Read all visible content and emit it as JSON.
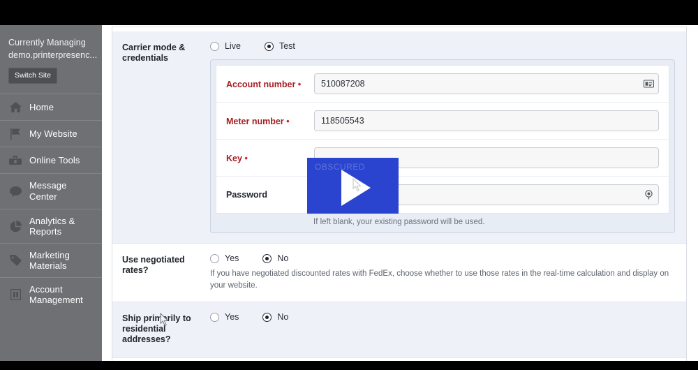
{
  "sidebar": {
    "managing_label": "Currently Managing",
    "site_name": "demo.printerpresenc...",
    "switch_site_label": "Switch Site",
    "items": [
      {
        "label": "Home",
        "icon": "home-icon"
      },
      {
        "label": "My Website",
        "icon": "flag-icon"
      },
      {
        "label": "Online Tools",
        "icon": "toolbox-icon"
      },
      {
        "label": "Message Center",
        "icon": "chat-bubble-icon"
      },
      {
        "label": "Analytics & Reports",
        "icon": "pie-chart-icon"
      },
      {
        "label": "Marketing Materials",
        "icon": "tag-icon"
      },
      {
        "label": "Account Management",
        "icon": "building-icon"
      }
    ]
  },
  "form": {
    "carrier_mode": {
      "label": "Carrier mode & credentials",
      "options": [
        {
          "label": "Live",
          "selected": false
        },
        {
          "label": "Test",
          "selected": true
        }
      ],
      "fields": [
        {
          "label": "Account number",
          "required": true,
          "value": "510087208",
          "icon": "contact-card-icon"
        },
        {
          "label": "Meter number",
          "required": true,
          "value": "118505543",
          "icon": ""
        },
        {
          "label": "Key",
          "required": true,
          "value": "",
          "icon": ""
        },
        {
          "label": "Password",
          "required": false,
          "value": "",
          "icon": "key-icon"
        }
      ],
      "password_hint": "If left blank, your existing password will be used."
    },
    "negotiated_rates": {
      "label": "Use negotiated rates?",
      "options": [
        {
          "label": "Yes",
          "selected": false
        },
        {
          "label": "No",
          "selected": true
        }
      ],
      "help": "If you have negotiated discounted rates with FedEx, choose whether to use those rates in the real-time calculation and display on your website."
    },
    "residential": {
      "label": "Ship primarily to residential addresses?",
      "options": [
        {
          "label": "Yes",
          "selected": false
        },
        {
          "label": "No",
          "selected": true
        }
      ]
    }
  },
  "video_overlay": {
    "play_label": "play-button",
    "obscured_text": "OBSCURED",
    "color": "#2b44cf"
  }
}
